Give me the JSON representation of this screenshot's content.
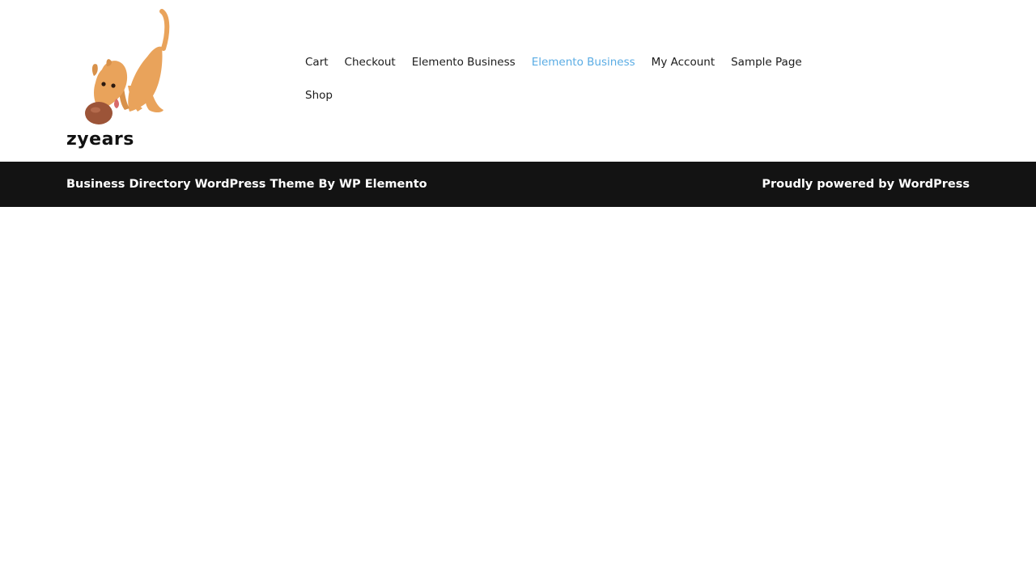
{
  "site": {
    "name": "zyears",
    "logo_icon": "cartoon-dog-logo-icon"
  },
  "nav": {
    "items": [
      {
        "label": "Cart"
      },
      {
        "label": "Checkout"
      },
      {
        "label": "Elemento Business"
      },
      {
        "label": "Elemento Business",
        "active": true
      },
      {
        "label": "My Account"
      },
      {
        "label": "Sample Page"
      },
      {
        "label": "Shop"
      }
    ]
  },
  "footer": {
    "credit_text": "Business Directory WordPress Theme By WP Elemento",
    "powered_text": "Proudly powered by WordPress"
  },
  "colors": {
    "nav_active": "#5aace4",
    "footer_bg": "#131313",
    "dog_body": "#e9a35b",
    "dog_nose": "#9c5438"
  }
}
